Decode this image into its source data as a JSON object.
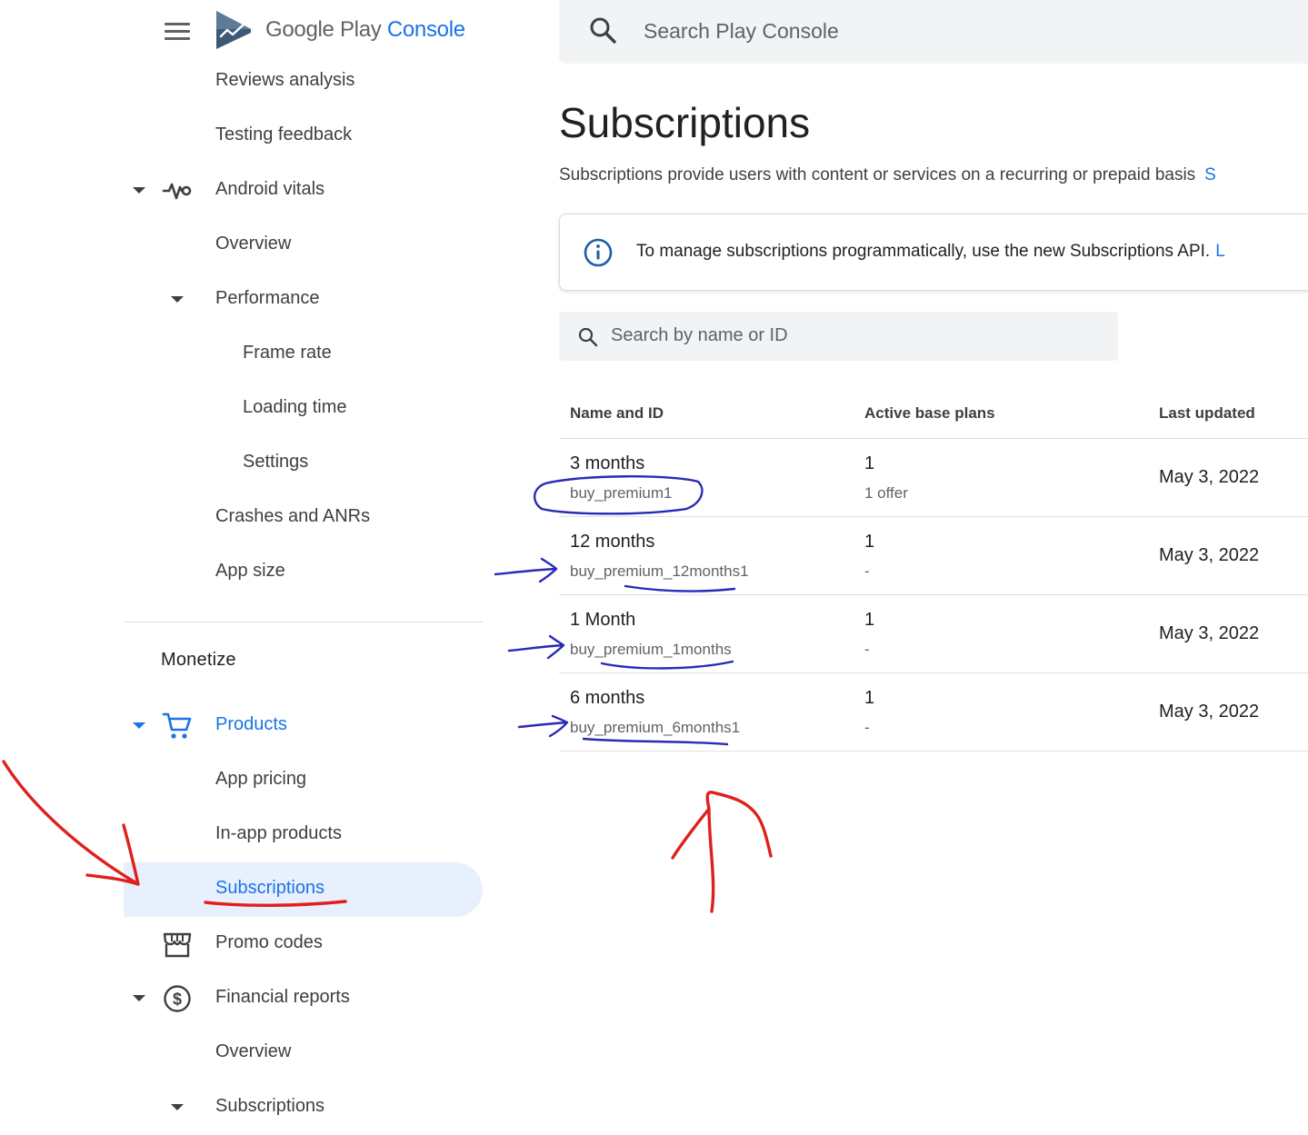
{
  "app": {
    "logo_text_main": "Google Play",
    "logo_text_accent": "Console",
    "search_placeholder": "Search Play Console"
  },
  "colors": {
    "accent": "#1a73e8",
    "active_bg": "#e8f0fe",
    "search_bg": "#f1f3f4",
    "annotation_red": "#e0201c",
    "annotation_blue": "#2a2ab8"
  },
  "sidebar": {
    "monetize_title": "Monetize",
    "items": [
      {
        "label": "Reviews analysis"
      },
      {
        "label": "Testing feedback"
      },
      {
        "label": "Android vitals",
        "icon": "vitals-icon",
        "expanded": true
      },
      {
        "label": "Overview"
      },
      {
        "label": "Performance",
        "expanded": true
      },
      {
        "label": "Frame rate"
      },
      {
        "label": "Loading time"
      },
      {
        "label": "Settings"
      },
      {
        "label": "Crashes and ANRs"
      },
      {
        "label": "App size"
      },
      {
        "label": "Products",
        "icon": "cart-icon",
        "expanded": true
      },
      {
        "label": "App pricing"
      },
      {
        "label": "In-app products"
      },
      {
        "label": "Subscriptions",
        "active": true
      },
      {
        "label": "Promo codes",
        "icon": "storefront-icon"
      },
      {
        "label": "Financial reports",
        "icon": "dollar-icon",
        "expanded": true
      },
      {
        "label": "Overview"
      },
      {
        "label": "Subscriptions",
        "expanded": true
      }
    ]
  },
  "main": {
    "title": "Subscriptions",
    "description": "Subscriptions provide users with content or services on a recurring or prepaid basis",
    "description_link": "S",
    "banner_text": "To manage subscriptions programmatically, use the new Subscriptions API.",
    "banner_link": "L",
    "table_search_placeholder": "Search by name or ID",
    "table": {
      "headers": [
        "Name and ID",
        "Active base plans",
        "Last updated"
      ],
      "rows": [
        {
          "name": "3 months",
          "id": "buy_premium1",
          "plans": "1",
          "offers": "1 offer",
          "updated": "May 3, 2022"
        },
        {
          "name": "12 months",
          "id": "buy_premium_12months1",
          "plans": "1",
          "offers": "-",
          "updated": "May 3, 2022"
        },
        {
          "name": "1 Month",
          "id": "buy_premium_1months",
          "plans": "1",
          "offers": "-",
          "updated": "May 3, 2022"
        },
        {
          "name": "6 months",
          "id": "buy_premium_6months1",
          "plans": "1",
          "offers": "-",
          "updated": "May 3, 2022"
        }
      ]
    }
  }
}
